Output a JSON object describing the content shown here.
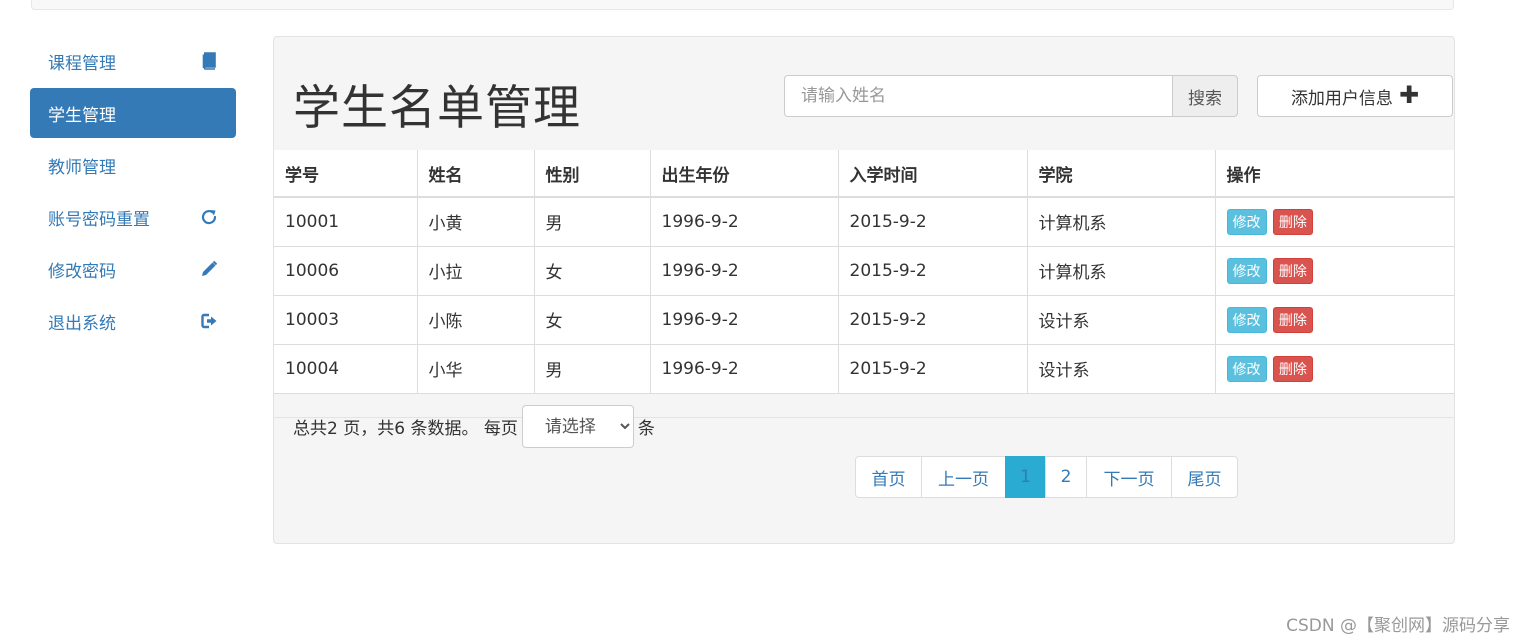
{
  "sidebar": {
    "items": [
      {
        "label": "课程管理",
        "icon": "book-icon",
        "active": false
      },
      {
        "label": "学生管理",
        "icon": "",
        "active": true
      },
      {
        "label": "教师管理",
        "icon": "",
        "active": false
      },
      {
        "label": "账号密码重置",
        "icon": "refresh-icon",
        "active": false
      },
      {
        "label": "修改密码",
        "icon": "pencil-icon",
        "active": false
      },
      {
        "label": "退出系统",
        "icon": "logout-icon",
        "active": false
      }
    ]
  },
  "main": {
    "title": "学生名单管理",
    "search": {
      "placeholder": "请输入姓名",
      "value": "",
      "button_label": "搜索"
    },
    "add_button_label": "添加用户信息",
    "table": {
      "headers": [
        "学号",
        "姓名",
        "性别",
        "出生年份",
        "入学时间",
        "学院",
        "操作"
      ],
      "rows": [
        [
          "10001",
          "小黄",
          "男",
          "1996-9-2",
          "2015-9-2",
          "计算机系"
        ],
        [
          "10006",
          "小拉",
          "女",
          "1996-9-2",
          "2015-9-2",
          "计算机系"
        ],
        [
          "10003",
          "小陈",
          "女",
          "1996-9-2",
          "2015-9-2",
          "设计系"
        ],
        [
          "10004",
          "小华",
          "男",
          "1996-9-2",
          "2015-9-2",
          "设计系"
        ]
      ],
      "edit_label": "修改",
      "delete_label": "删除"
    },
    "pagination": {
      "summary": "总共2 页，共6 条数据。 每页",
      "select_value": "请选择",
      "unit": "条",
      "links": [
        "首页",
        "上一页",
        "1",
        "2",
        "下一页",
        "尾页"
      ],
      "active_page": "1"
    }
  },
  "watermark": "CSDN @【聚创网】源码分享",
  "colors": {
    "primary": "#337ab7",
    "info": "#5bc0de",
    "danger": "#d9534f",
    "active_page": "#2aabd2",
    "panel_bg": "#f5f5f5"
  }
}
